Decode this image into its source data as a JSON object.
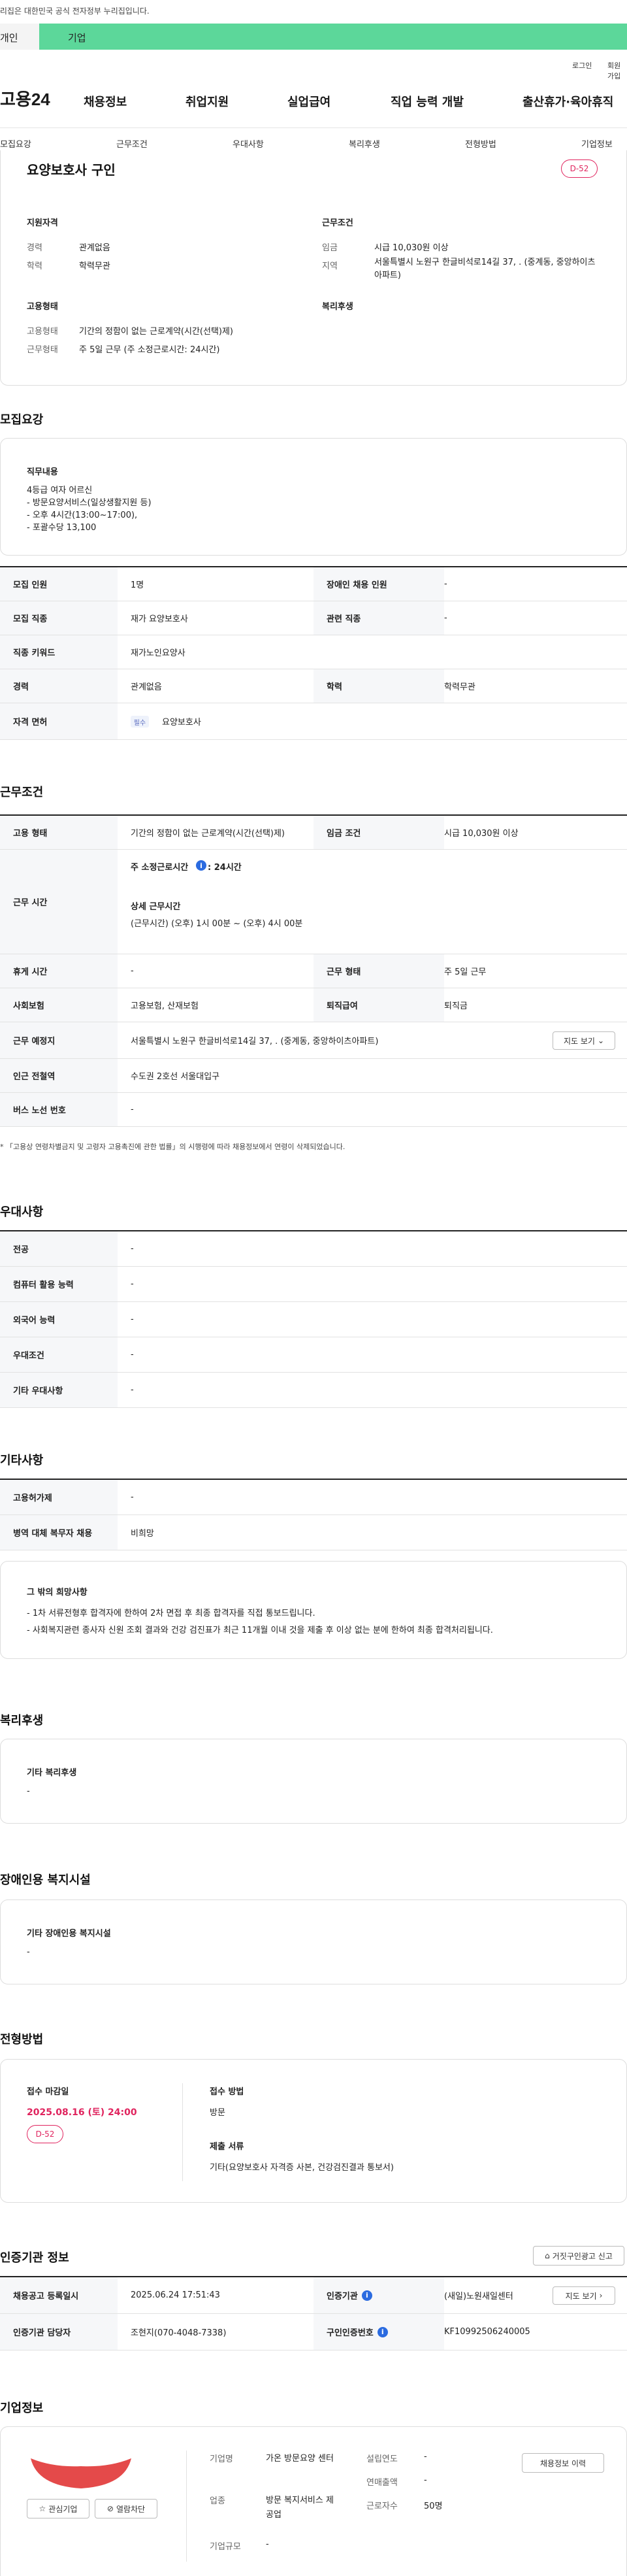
{
  "gov_banner": {
    "text": "이 누리집은 대한민국 공식 전자정부 누리집입니다."
  },
  "member_tabs": {
    "personal": "개인",
    "company": "기업"
  },
  "util": {
    "login": "로그인",
    "join": "회원가입"
  },
  "logo": {
    "text": "고용24"
  },
  "gnb": [
    "채용정보",
    "취업지원",
    "실업급여",
    "직업 능력 개발",
    "출산휴가·육아휴직"
  ],
  "subnav": [
    "모집요강",
    "근무조건",
    "우대사항",
    "복리후생",
    "전형방법",
    "기업정보"
  ],
  "summary": {
    "title": "요양보호사 구인",
    "dday": "D-52",
    "qual_heading": "지원자격",
    "career_label": "경력",
    "career_value": "관계없음",
    "edu_label": "학력",
    "edu_value": "학력무관",
    "cond_heading": "근무조건",
    "wage_label": "임금",
    "wage_value": "시급 10,030원 이상",
    "loc_label": "지역",
    "loc_value": "서울특별시 노원구 한글비석로14길 37, . (중계동, 중앙하이츠아파트)",
    "emp_heading": "고용형태",
    "emptype_label": "고용형태",
    "emptype_value": "기간의 정함이 없는 근로계약(시간(선택)제)",
    "worktype_label": "근무형태",
    "worktype_value": "주 5일 근무 (주 소정근로시간: 24시간)",
    "welfare_heading": "복리후생"
  },
  "recruit": {
    "heading": "모집요강",
    "duty_heading": "직무내용",
    "duty_text": "4등급 여자 어르신\n- 방문요양서비스(일상생활지원 등)\n- 오후 4시간(13:00~17:00),\n- 포괄수당 13,100",
    "r1_l": "모집 인원",
    "r1_v": "1명",
    "r1_l2": "장애인 채용 인원",
    "r1_v2": "-",
    "r2_l": "모집 직종",
    "r2_v": "재가 요양보호사",
    "r2_l2": "관련 직종",
    "r2_v2": "-",
    "r3_l": "직종 키워드",
    "r3_v": "재가노인요양사",
    "r4_l": "경력",
    "r4_v": "관계없음",
    "r4_l2": "학력",
    "r4_v2": "학력무관",
    "r5_l": "자격 면허",
    "r5_pill": "필수",
    "r5_v": "요양보호사"
  },
  "work": {
    "heading": "근무조건",
    "r1_l": "고용 형태",
    "r1_v": "기간의 정함이 없는 근로계약(시간(선택)제)",
    "r1_l2": "임금 조건",
    "r1_v2": "시급 10,030원 이상",
    "r2_l": "근무 시간",
    "r2_a_label": "주 소정근로시간",
    "r2_a_info": "i",
    "r2_a_value": ": 24시간",
    "r2_b_label": "상세 근무시간",
    "r2_b_value": "(근무시간) (오후) 1시 00분 ~ (오후) 4시 00분",
    "r3_l": "휴게 시간",
    "r3_v": "-",
    "r3_l2": "근무 형태",
    "r3_v2": "주 5일 근무",
    "r4_l": "사회보험",
    "r4_v": "고용보험, 산재보험",
    "r4_l2": "퇴직급여",
    "r4_v2": "퇴직금",
    "r5_l": "근무 예정지",
    "r5_v": "서울특별시 노원구 한글비석로14길 37, . (중계동, 중앙하이츠아파트)",
    "r5_btn": "지도 보기",
    "r6_l": "인근 전철역",
    "r6_v": "수도권 2호선 서울대입구",
    "r7_l": "버스 노선 번호",
    "r7_v": "-",
    "note": "* 「고용상 연령차별금지 및 고령자 고용촉진에 관한 법률」의 시행령에 따라 채용정보에서 연령이 삭제되었습니다."
  },
  "pref": {
    "heading": "우대사항",
    "rows": [
      {
        "l": "전공",
        "v": "-"
      },
      {
        "l": "컴퓨터 활용 능력",
        "v": "-"
      },
      {
        "l": "외국어 능력",
        "v": "-"
      },
      {
        "l": "우대조건",
        "v": "-"
      },
      {
        "l": "기타 우대사항",
        "v": "-"
      }
    ]
  },
  "etc": {
    "heading": "기타사항",
    "r1_l": "고용허가제",
    "r1_v": "-",
    "r2_l": "병역 대체 복무자 채용",
    "r2_v": "비희망",
    "wish_heading": "그 밖의 희망사항",
    "wish_1": "- 1차 서류전형후 합격자에 한하여 2차 면접 후 최종 합격자를 직접 통보드립니다.",
    "wish_2": "- 사회복지관련 종사자 신원 조회 결과와 건강 검진표가 최근 11개월 이내 것을 제출 후 이상 없는 분에 한하여  최종 합격처리됩니다."
  },
  "welfare": {
    "heading": "복리후생",
    "sub": "기타 복리후생",
    "value": "-"
  },
  "disabled": {
    "heading": "장애인용 복지시설",
    "sub": "기타 장애인용 복지시설",
    "value": "-"
  },
  "selection": {
    "heading": "전형방법",
    "deadline_label": "접수 마감일",
    "deadline_value": "2025.08.16 (토) 24:00",
    "dday": "D-52",
    "method_label": "접수 방법",
    "method_value": "방문",
    "docs_label": "제출 서류",
    "docs_value": "기타(요양보호사 자격증 사본, 건강검진결과 통보서)"
  },
  "agency": {
    "heading": "인증기관 정보",
    "report_btn": "거짓구인광고 신고",
    "r1_l": "채용공고 등록일시",
    "r1_v": "2025.06.24 17:51:43",
    "r1_l2": "인증기관",
    "r1_v2": "(새일)노원새일센터",
    "map_btn": "지도 보기",
    "r2_l": "인증기관 담당자",
    "r2_v": "조현지(070-4048-7338)",
    "r2_l2": "구인인증번호",
    "r2_v2": "KF10992506240005"
  },
  "company": {
    "heading": "기업정보",
    "fav_btn": "관심기업",
    "block_btn": "열람차단",
    "name_l": "기업명",
    "name_v": "가온 방문요양 센터",
    "found_l": "설립연도",
    "found_v": "-",
    "industry_l": "업종",
    "industry_v": "방문 복지서비스 제공업",
    "sales_l": "연매출액",
    "sales_v": "-",
    "staff_l": "근로자수",
    "staff_v": "50명",
    "size_l": "기업규모",
    "size_v": "-",
    "jobs_btn": "채용정보 이력"
  },
  "colors": {
    "accent_green": "#5cd79a",
    "dday_red": "#e0245e",
    "info_blue": "#2b6be0"
  }
}
